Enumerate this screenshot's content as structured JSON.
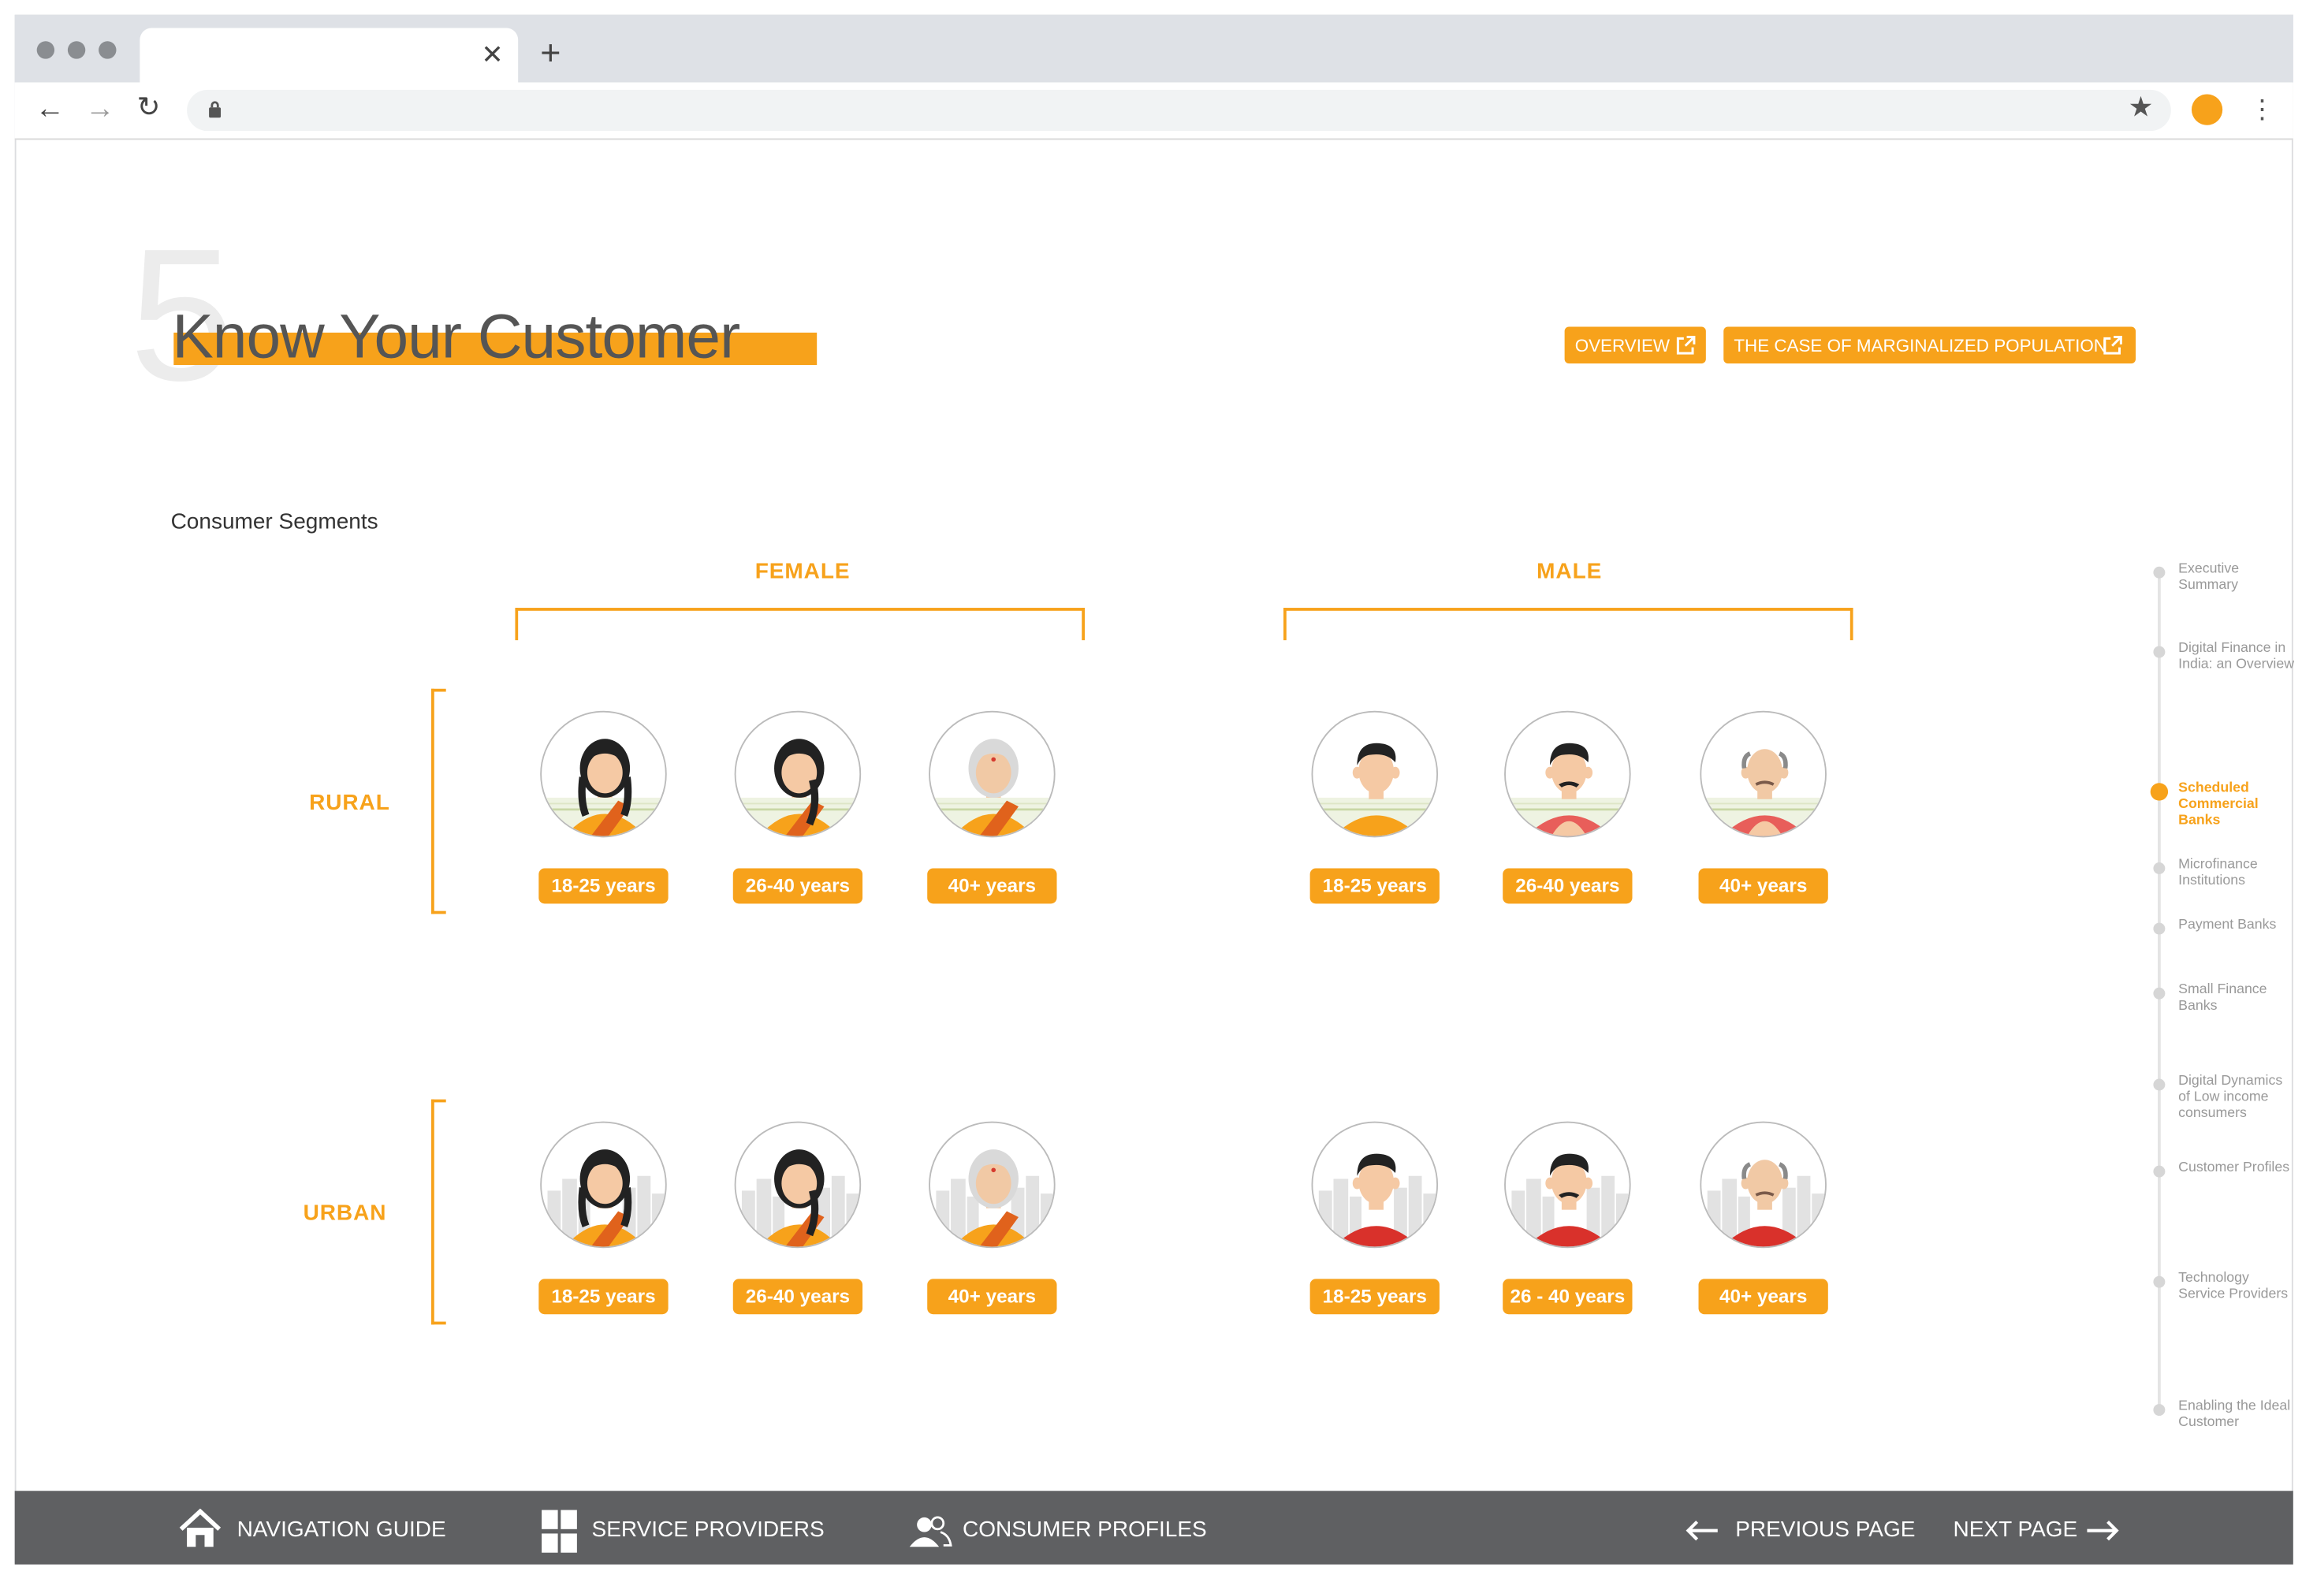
{
  "page": {
    "section_number": "5",
    "title": "Know Your Customer",
    "buttons": {
      "overview": "OVERVIEW",
      "marginalized": "THE CASE OF MARGINALIZED POPULATION"
    },
    "segments_label": "Consumer Segments",
    "female_label": "FEMALE",
    "male_label": "MALE",
    "rural_label": "RURAL",
    "urban_label": "URBAN",
    "rural_ages": [
      "18-25 years",
      "26-40 years",
      "40+ years",
      "18-25 years",
      "26-40 years",
      "40+ years"
    ],
    "urban_ages": [
      "18-25 years",
      "26-40 years",
      "40+ years",
      "18-25 years",
      "26 - 40 years",
      "40+ years"
    ]
  },
  "sidenav": [
    "Executive Summary",
    "Digital Finance in India: an Overview",
    "Scheduled Commercial Banks",
    "Microfinance Institutions",
    "Payment Banks",
    "Small Finance Banks",
    "Digital Dynamics of Low income consumers",
    "Customer Profiles",
    "Technology Service Providers",
    "Enabling the Ideal Customer"
  ],
  "sidenav_active": "Scheduled Commercial Banks",
  "footer": {
    "navigation_guide": "NAVIGATION GUIDE",
    "service_providers": "SERVICE PROVIDERS",
    "consumer_profiles": "CONSUMER PROFILES",
    "previous_page": "PREVIOUS PAGE",
    "next_page": "NEXT PAGE"
  },
  "colors": {
    "accent": "#f7a21b",
    "footer_bg": "#5f6062",
    "title_text": "#555555"
  },
  "icons": {
    "home": "home-icon",
    "grid": "grid-icon",
    "users": "users-icon",
    "prev": "arrow-left-icon",
    "next": "arrow-right-icon",
    "external": "external-link-icon"
  }
}
